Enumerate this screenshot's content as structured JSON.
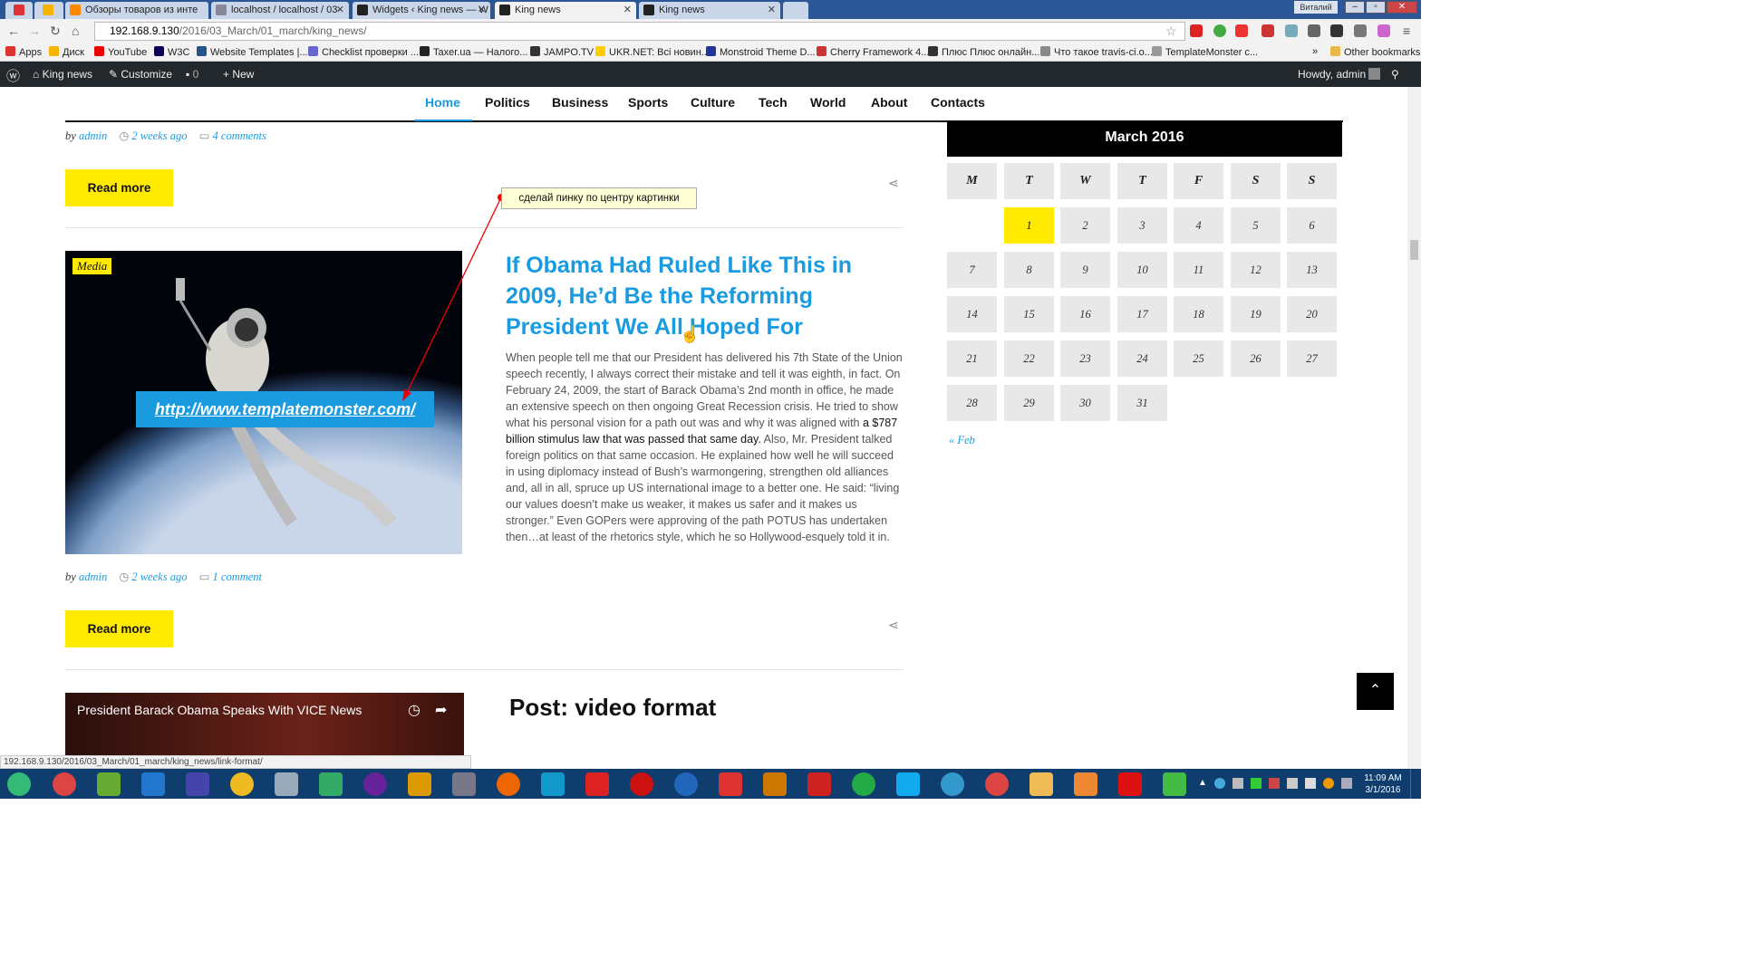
{
  "browser": {
    "tabs": [
      {
        "label": "",
        "active": false
      },
      {
        "label": "",
        "active": false
      },
      {
        "label": "Обзоры товаров из инте",
        "active": false
      },
      {
        "label": "localhost / localhost / 03-",
        "active": false
      },
      {
        "label": "Widgets ‹ King news — W",
        "active": false
      },
      {
        "label": "King news",
        "active": true
      },
      {
        "label": "King news",
        "active": false
      }
    ],
    "window_user": "Виталий",
    "address": {
      "host": "192.168.9.130",
      "path": "/2016/03_March/01_march/king_news/"
    },
    "bookmarks": [
      {
        "label": "Apps",
        "color": "#d33"
      },
      {
        "label": "Диск",
        "color": "#f4b400"
      },
      {
        "label": "YouTube",
        "color": "#e00"
      },
      {
        "label": "W3C",
        "color": "#105"
      },
      {
        "label": "Website Templates |...",
        "color": "#258"
      },
      {
        "label": "Checklist проверки ...",
        "color": "#66c"
      },
      {
        "label": "Taxer.ua — Налого...",
        "color": "#222"
      },
      {
        "label": "JAMPO.TV",
        "color": "#333"
      },
      {
        "label": "UKR.NET: Всі новин...",
        "color": "#fc0"
      },
      {
        "label": "Monstroid Theme D...",
        "color": "#239"
      },
      {
        "label": "Cherry Framework 4...",
        "color": "#c33"
      },
      {
        "label": "Плюс Плюс онлайн...",
        "color": "#333"
      },
      {
        "label": "Что такое travis-ci.o...",
        "color": "#888"
      },
      {
        "label": "TemplateMonster c...",
        "color": "#999"
      }
    ],
    "other_bookmarks": "Other bookmarks",
    "status_url": "192.168.9.130/2016/03_March/01_march/king_news/link-format/"
  },
  "adminbar": {
    "site": "King news",
    "customize": "Customize",
    "comments": "0",
    "new": "New",
    "howdy": "Howdy, admin"
  },
  "nav": {
    "items": [
      "Home",
      "Politics",
      "Business",
      "Sports",
      "Culture",
      "Tech",
      "World",
      "About",
      "Contacts"
    ]
  },
  "post1_meta": {
    "by": "by",
    "author": "admin",
    "date": "2 weeks ago",
    "comments": "4 comments"
  },
  "read_more": "Read more",
  "annotation": "сделай пинку по центру картинки",
  "post2": {
    "badge": "Media",
    "link": "http://www.templatemonster.com/",
    "title": "If Obama Had Ruled Like This in 2009, He’d Be the Reforming President We All Hoped For",
    "body_a": "When people tell me that our President has delivered his 7th State of the Union speech recently, I always correct their mistake and tell it was eighth, in fact. On February 24, 2009, the start of Barack Obama’s 2nd month in office, he made an extensive speech on then ongoing Great Recession crisis. He tried to show what his personal vision for a path out was and why it was aligned with ",
    "body_b": "a $787 billion stimulus law that was passed that same day.",
    "body_c": " Also, Mr. President talked foreign politics on that same occasion. He explained how well he will succeed in using diplomacy instead of Bush’s warmongering, strengthen old alliances and, all in all, spruce up US international image to a better one. He said: “living our values doesn’t make us weaker, it makes us safer and it makes us stronger.” Even GOPers were approving of the path POTUS has undertaken then…at least of the rhetorics style, which he so Hollywood-esquely told it in.",
    "meta": {
      "by": "by",
      "author": "admin",
      "date": "2 weeks ago",
      "comments": "1 comment"
    }
  },
  "post3": {
    "video_title": "President Barack Obama Speaks With VICE News",
    "heading": "Post: video format"
  },
  "calendar": {
    "title": "March 2016",
    "dow": [
      "M",
      "T",
      "W",
      "T",
      "F",
      "S",
      "S"
    ],
    "start_offset": 1,
    "days": 31,
    "today": 1,
    "prev": "« Feb"
  },
  "taskbar": {
    "time": "11:09 AM",
    "date": "3/1/2016"
  }
}
